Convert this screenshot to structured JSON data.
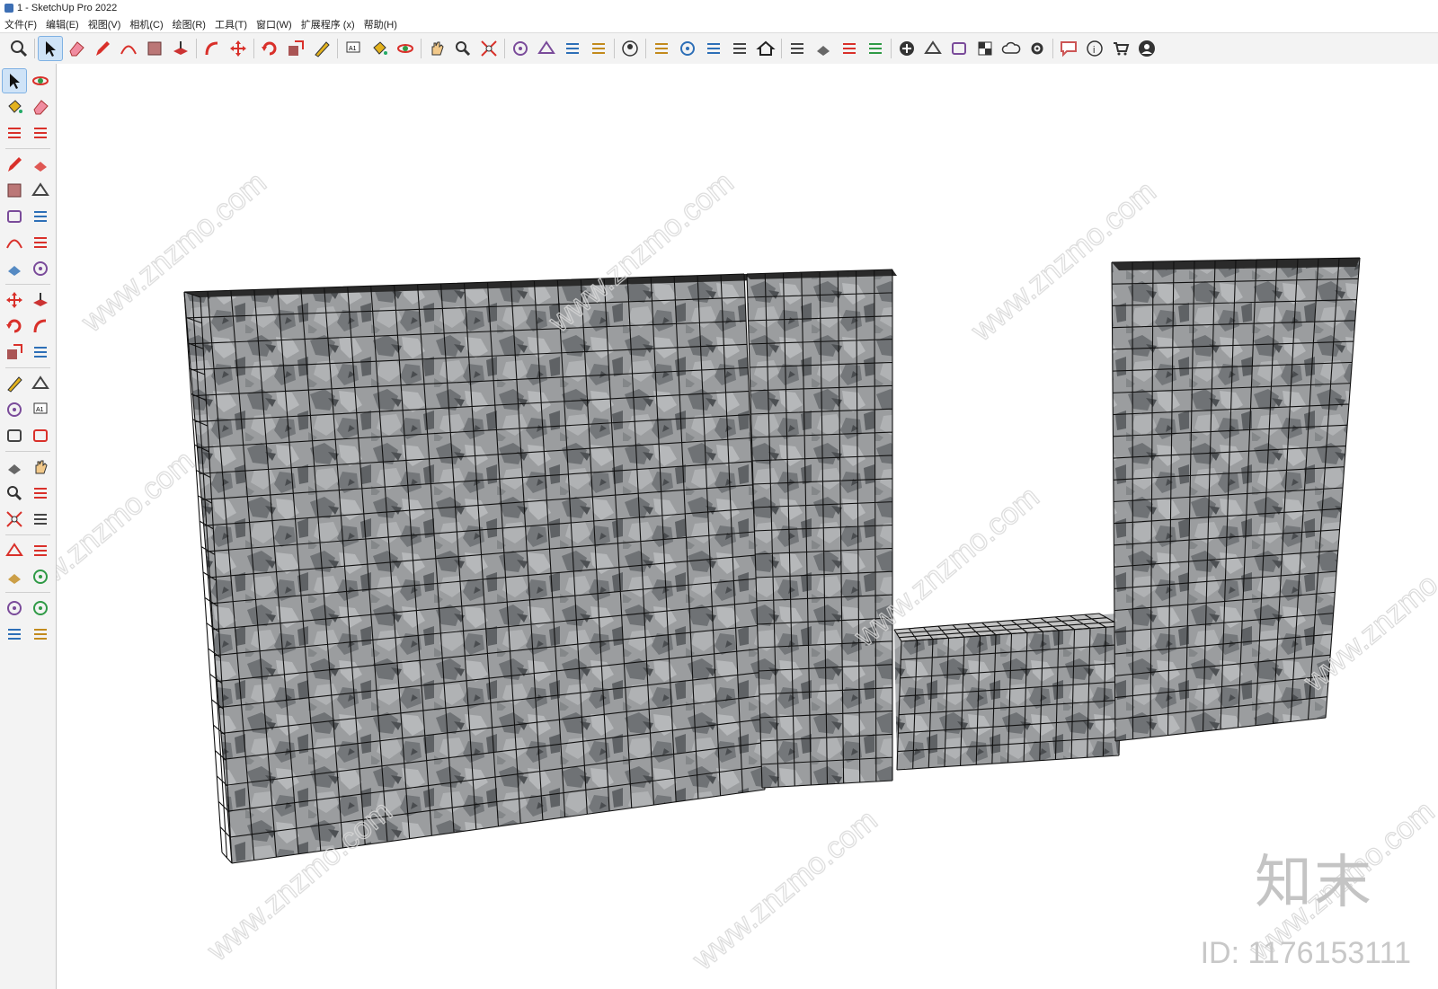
{
  "window": {
    "title": "1 - SketchUp Pro 2022"
  },
  "menu": [
    {
      "label": "文件(F)"
    },
    {
      "label": "编辑(E)"
    },
    {
      "label": "视图(V)"
    },
    {
      "label": "相机(C)"
    },
    {
      "label": "绘图(R)"
    },
    {
      "label": "工具(T)"
    },
    {
      "label": "窗口(W)"
    },
    {
      "label": "扩展程序 (x)"
    },
    {
      "label": "帮助(H)"
    }
  ],
  "toolbar": {
    "active_tool": "select-icon",
    "top_icons": [
      "zoom-icon",
      "select-icon",
      "eraser-icon",
      "pencil-icon",
      "arc-icon",
      "rectangle-icon",
      "push-pull-icon",
      "follow-me-icon",
      "move-icon",
      "rotate-icon",
      "scale-icon",
      "tape-measure-icon",
      "text-icon",
      "paint-bucket-icon",
      "orbit-icon",
      "pan-icon",
      "zoom-tool-icon",
      "zoom-extents-icon",
      "warehouse-icon",
      "extension-warehouse-icon",
      "layer-icon",
      "sandbox-icon",
      "account-icon",
      "iso-view-icon",
      "front-view-icon",
      "home-view-icon",
      "back-view-icon",
      "house-icon",
      "section-icon",
      "style-icon",
      "component-icon",
      "swap-icon",
      "add-icon",
      "solid-icon",
      "shadow-icon",
      "checker-icon",
      "cloud-icon",
      "settings-icon",
      "message-icon",
      "info-icon",
      "cart-icon",
      "profile-icon"
    ],
    "left_icons": [
      "select-icon",
      "orbit-icon",
      "paint-bucket-icon",
      "eraser-icon",
      "component-icon",
      "tag-icon",
      "pencil-icon",
      "freehand-icon",
      "rectangle-icon",
      "rotated-rectangle-icon",
      "circle-icon",
      "polygon-icon",
      "arc-icon",
      "arc-2pt-icon",
      "arc-3pt-icon",
      "pie-icon",
      "move-icon",
      "push-pull-icon",
      "rotate-icon",
      "follow-me-icon",
      "scale-icon",
      "offset-icon",
      "tape-measure-icon",
      "dimension-icon",
      "protractor-icon",
      "text-icon",
      "axes-icon",
      "3d-text-icon",
      "orbit-tool-icon",
      "pan-icon",
      "zoom-tool-icon",
      "zoom-window-icon",
      "zoom-extents-icon",
      "previous-view-icon",
      "position-camera-icon",
      "look-around-icon",
      "walk-icon",
      "section-plane-icon",
      "warehouse-icon",
      "extension-icon",
      "layer-icon",
      "sandbox-icon"
    ]
  },
  "viewport": {
    "watermark_url": "www.znzmo.com",
    "watermark_brand": "知末",
    "watermark_id": "ID: 1176153111",
    "stone_color": "#8b8d90",
    "mesh_color": "#111111"
  }
}
